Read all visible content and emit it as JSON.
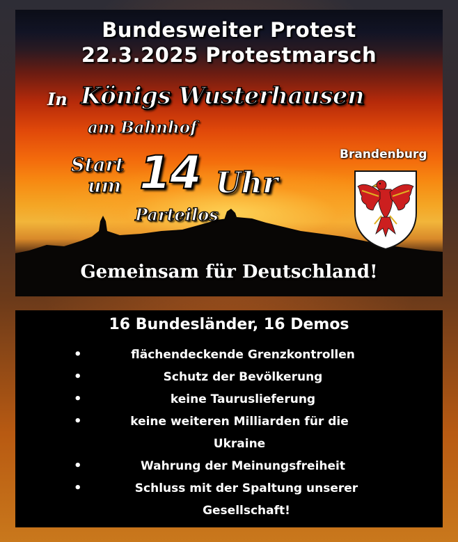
{
  "header": {
    "line1": "Bundesweiter Protest",
    "line2": "22.3.2025 Protestmarsch"
  },
  "event": {
    "in_label": "In",
    "city": "Königs Wusterhausen",
    "location": "am Bahnhof",
    "start_label": "Start",
    "um_label": "um",
    "time": "14",
    "time_unit": "Uhr",
    "affiliation": "Parteilos"
  },
  "state": {
    "name": "Brandenburg",
    "crest_icon": "brandenburg-eagle-crest-icon",
    "crest_colors": {
      "eagle": "#cc1f1f",
      "shield": "#ffffff",
      "outline": "#000000"
    }
  },
  "slogan": "Gemeinsam für Deutschland!",
  "demands": {
    "title": "16 Bundesländer, 16 Demos",
    "items": [
      "flächendeckende Grenzkontrollen",
      "Schutz der Bevölkerung",
      "keine Tauruslieferung",
      "keine weiteren Milliarden für die Ukraine",
      "Wahrung der Meinungsfreiheit",
      "Schluss mit der Spaltung unserer Gesellschaft!"
    ]
  },
  "colors": {
    "sky_top": "#0b0d17",
    "sunset_red": "#b52a0a",
    "sunset_orange": "#f36a0c",
    "sunset_yellow": "#f4a524",
    "text": "#ffffff",
    "list_background": "#000000"
  }
}
